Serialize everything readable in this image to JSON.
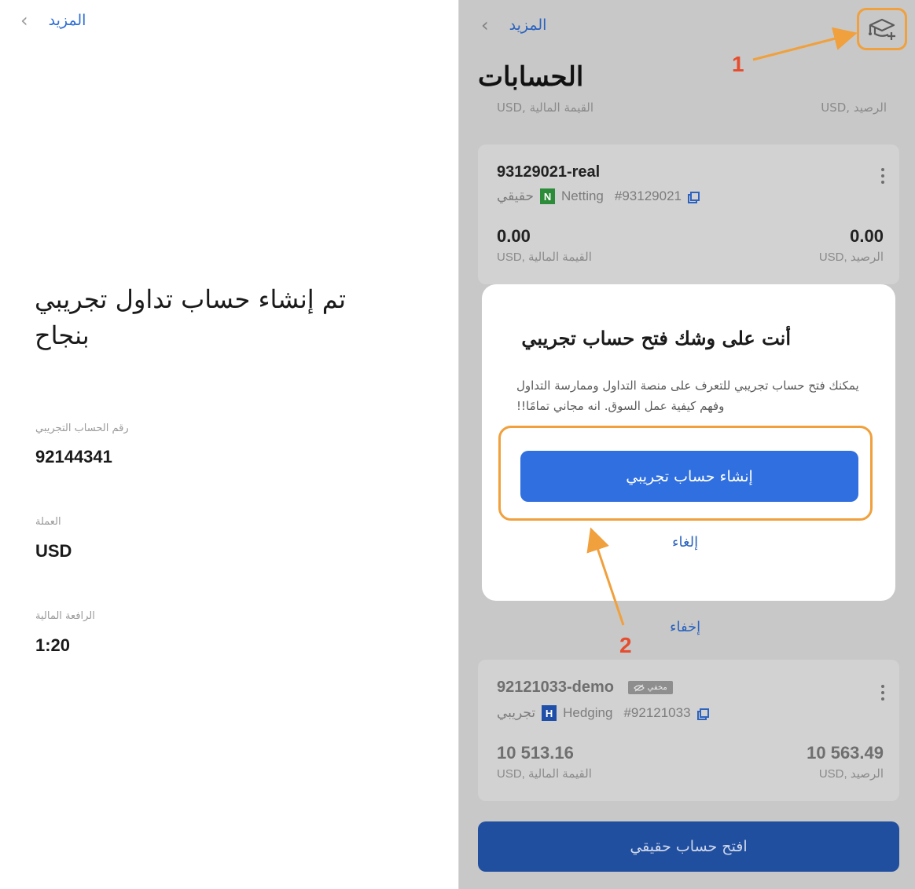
{
  "left": {
    "back_label": "المزيد",
    "title": "تم إنشاء حساب تداول تجريبي بنجاح",
    "fields": [
      {
        "label": "رقم الحساب التجريبي",
        "value": "92144341"
      },
      {
        "label": "العملة",
        "value": "USD"
      },
      {
        "label": "الرافعة المالية",
        "value": "1:20"
      }
    ]
  },
  "right": {
    "back_label": "المزيد",
    "title": "الحسابات",
    "partial_row": {
      "left": "USD, القيمة المالية",
      "right": "USD, الرصيد"
    },
    "accounts": [
      {
        "name": "93129021-real",
        "id": "#93129021",
        "mode_badge": "N",
        "mode": "Netting",
        "type": "حقيقي",
        "equity": "0.00",
        "equity_label": "USD, القيمة المالية",
        "balance": "0.00",
        "balance_label": "USD, الرصيد"
      },
      {
        "name": "92121033-demo",
        "hidden_badge": "مخفي",
        "id": "#92121033",
        "mode_badge": "H",
        "mode": "Hedging",
        "type": "تجريبي",
        "equity": "10 513.16",
        "equity_label": "USD, القيمة المالية",
        "balance": "10 563.49",
        "balance_label": "USD, الرصيد"
      }
    ],
    "hide_label": "إخفاء",
    "open_real_label": "افتح حساب حقيقي",
    "modal": {
      "title": "أنت على وشك فتح حساب تجريبي",
      "body": "يمكنك فتح حساب تجريبي للتعرف على منصة التداول وممارسة التداول وفهم كيفية عمل السوق. انه مجاني تمامًا!!",
      "create_label": "إنشاء حساب تجريبي",
      "cancel_label": "إلغاء"
    },
    "annotations": {
      "step1": "1",
      "step2": "2"
    },
    "colors": {
      "accent": "#2f6fdf",
      "highlight": "#f0a03c",
      "step": "#e54d2e"
    }
  }
}
